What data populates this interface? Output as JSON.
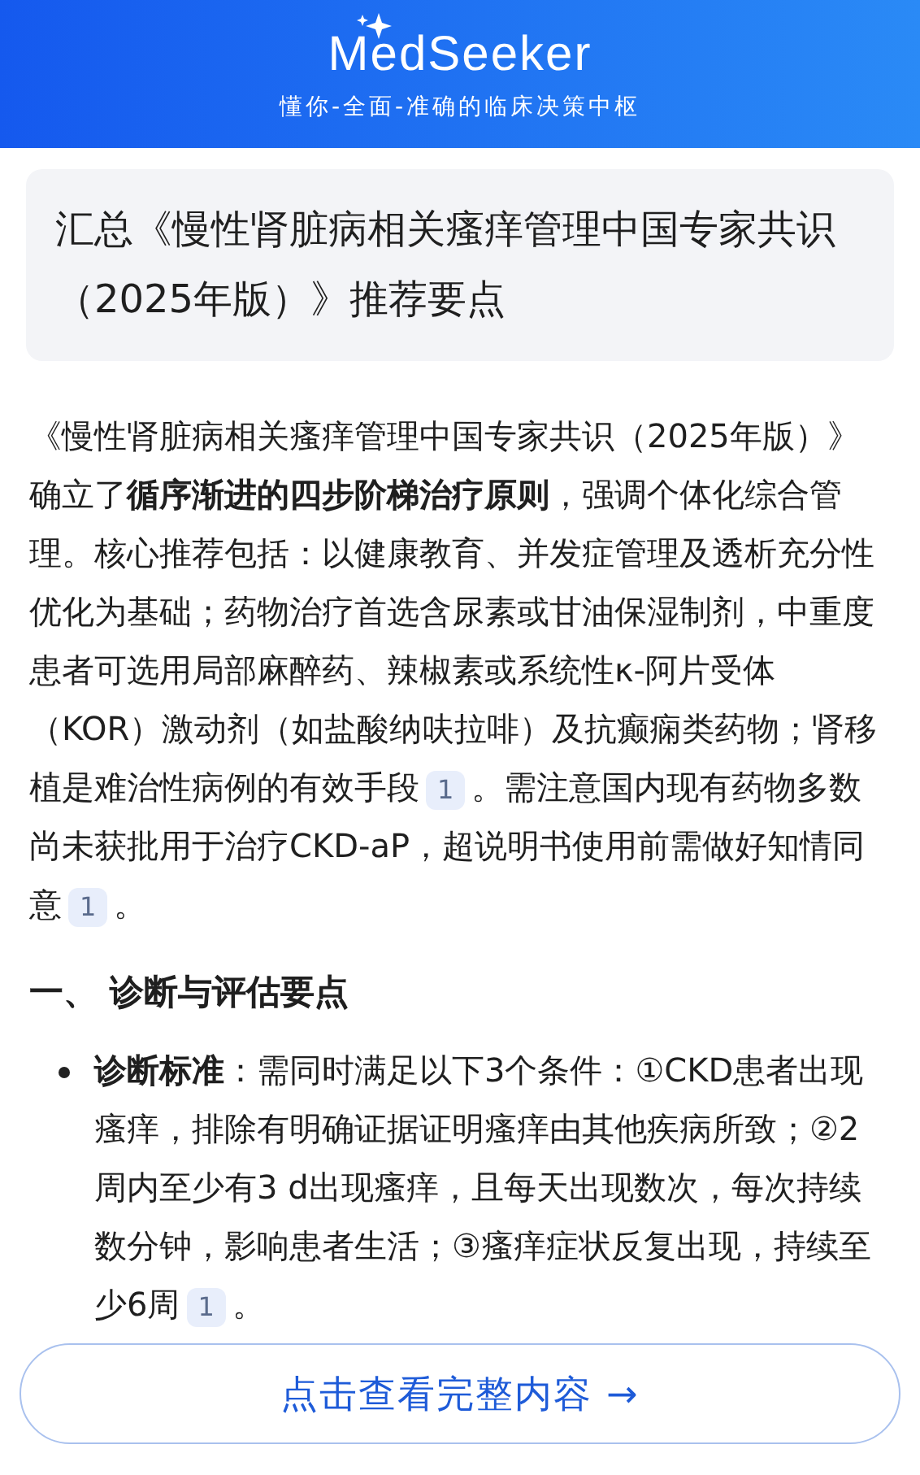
{
  "header": {
    "logo": "MedSeeker",
    "tagline": "懂你-全面-准确的临床决策中枢"
  },
  "question": "汇总《慢性肾脏病相关瘙痒管理中国专家共识（2025年版）》推荐要点",
  "summary": [
    {
      "text": "《慢性肾脏病相关瘙痒管理中国专家共识（2025年版）》确立了**循序渐进的四步阶梯治疗原则**，强调个体化综合管理。核心推荐包括：以健康教育、并发症管理及透析充分性优化为基础；药物治疗首选含尿素或甘油保湿制剂，中重度患者可选用局部麻醉药、辣椒素或系统性κ-阿片受体（KOR）激动剂（如盐酸纳呋拉啡）及抗癫痫类药物；肾移植是难治性病例的有效手段"
    },
    {
      "cite": "1"
    },
    {
      "text": "。需注意国内现有药物多数尚未获批用于治疗CKD-aP，超说明书使用前需做好知情同意"
    },
    {
      "cite": "1"
    },
    {
      "text": "。"
    }
  ],
  "section_heading": "一、 诊断与评估要点",
  "bullets": [
    {
      "label": "诊断标准",
      "segments": [
        {
          "text": "：需同时满足以下3个条件：①CKD患者出现瘙痒，排除有明确证据证明瘙痒由其他疾病所致；②2周内至少有3 d出现瘙痒，且每天出现数次，每次持续数分钟，影响患者生活；③瘙痒症状反复出现，持续至少6周"
        },
        {
          "cite": "1"
        },
        {
          "text": "。"
        }
      ]
    }
  ],
  "more_button": "点击查看完整内容 →"
}
